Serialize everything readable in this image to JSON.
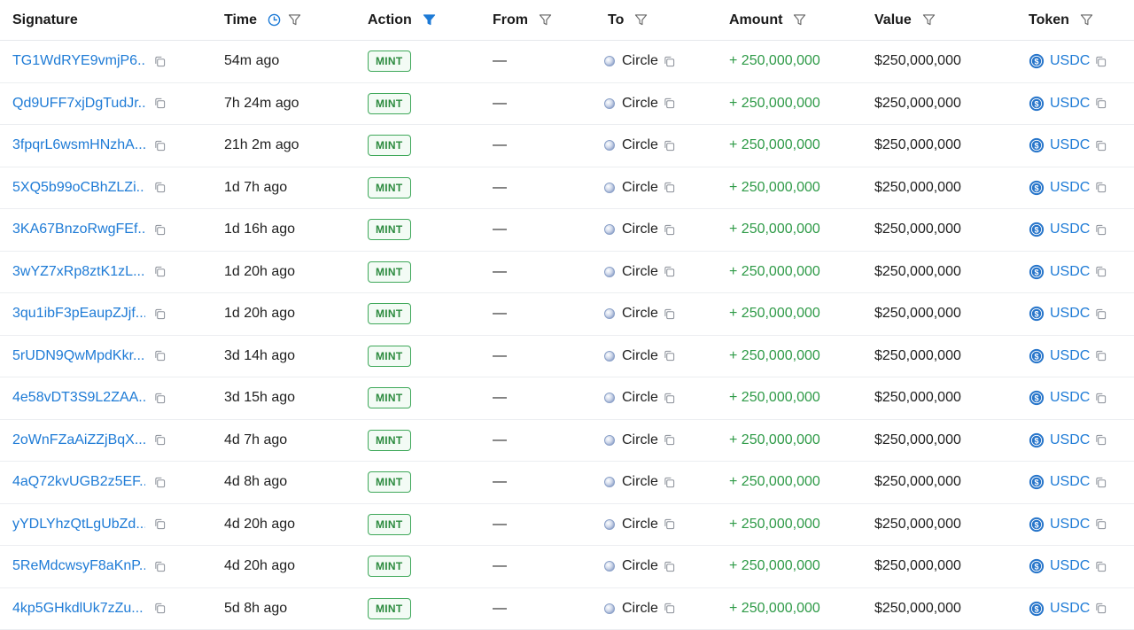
{
  "columns": {
    "signature": "Signature",
    "time": "Time",
    "action": "Action",
    "from": "From",
    "to": "To",
    "amount": "Amount",
    "value": "Value",
    "token": "Token"
  },
  "accent_color": "#1e7bd6",
  "positive_color": "#2e9a47",
  "rows": [
    {
      "signature": "TG1WdRYE9vmjP6...",
      "time": "54m ago",
      "action": "MINT",
      "from": "—",
      "to": "Circle",
      "amount": "+ 250,000,000",
      "value": "$250,000,000",
      "token": "USDC"
    },
    {
      "signature": "Qd9UFF7xjDgTudJr...",
      "time": "7h 24m ago",
      "action": "MINT",
      "from": "—",
      "to": "Circle",
      "amount": "+ 250,000,000",
      "value": "$250,000,000",
      "token": "USDC"
    },
    {
      "signature": "3fpqrL6wsmHNzhA...",
      "time": "21h 2m ago",
      "action": "MINT",
      "from": "—",
      "to": "Circle",
      "amount": "+ 250,000,000",
      "value": "$250,000,000",
      "token": "USDC"
    },
    {
      "signature": "5XQ5b99oCBhZLZi...",
      "time": "1d 7h ago",
      "action": "MINT",
      "from": "—",
      "to": "Circle",
      "amount": "+ 250,000,000",
      "value": "$250,000,000",
      "token": "USDC"
    },
    {
      "signature": "3KA67BnzoRwgFEf...",
      "time": "1d 16h ago",
      "action": "MINT",
      "from": "—",
      "to": "Circle",
      "amount": "+ 250,000,000",
      "value": "$250,000,000",
      "token": "USDC"
    },
    {
      "signature": "3wYZ7xRp8ztK1zL...",
      "time": "1d 20h ago",
      "action": "MINT",
      "from": "—",
      "to": "Circle",
      "amount": "+ 250,000,000",
      "value": "$250,000,000",
      "token": "USDC"
    },
    {
      "signature": "3qu1ibF3pEaupZJjf...",
      "time": "1d 20h ago",
      "action": "MINT",
      "from": "—",
      "to": "Circle",
      "amount": "+ 250,000,000",
      "value": "$250,000,000",
      "token": "USDC"
    },
    {
      "signature": "5rUDN9QwMpdKkr...",
      "time": "3d 14h ago",
      "action": "MINT",
      "from": "—",
      "to": "Circle",
      "amount": "+ 250,000,000",
      "value": "$250,000,000",
      "token": "USDC"
    },
    {
      "signature": "4e58vDT3S9L2ZAA...",
      "time": "3d 15h ago",
      "action": "MINT",
      "from": "—",
      "to": "Circle",
      "amount": "+ 250,000,000",
      "value": "$250,000,000",
      "token": "USDC"
    },
    {
      "signature": "2oWnFZaAiZZjBqX...",
      "time": "4d 7h ago",
      "action": "MINT",
      "from": "—",
      "to": "Circle",
      "amount": "+ 250,000,000",
      "value": "$250,000,000",
      "token": "USDC"
    },
    {
      "signature": "4aQ72kvUGB2z5EF...",
      "time": "4d 8h ago",
      "action": "MINT",
      "from": "—",
      "to": "Circle",
      "amount": "+ 250,000,000",
      "value": "$250,000,000",
      "token": "USDC"
    },
    {
      "signature": "yYDLYhzQtLgUbZd...",
      "time": "4d 20h ago",
      "action": "MINT",
      "from": "—",
      "to": "Circle",
      "amount": "+ 250,000,000",
      "value": "$250,000,000",
      "token": "USDC"
    },
    {
      "signature": "5ReMdcwsyF8aKnP...",
      "time": "4d 20h ago",
      "action": "MINT",
      "from": "—",
      "to": "Circle",
      "amount": "+ 250,000,000",
      "value": "$250,000,000",
      "token": "USDC"
    },
    {
      "signature": "4kp5GHkdlUk7zZu...",
      "time": "5d 8h ago",
      "action": "MINT",
      "from": "—",
      "to": "Circle",
      "amount": "+ 250,000,000",
      "value": "$250,000,000",
      "token": "USDC"
    }
  ]
}
